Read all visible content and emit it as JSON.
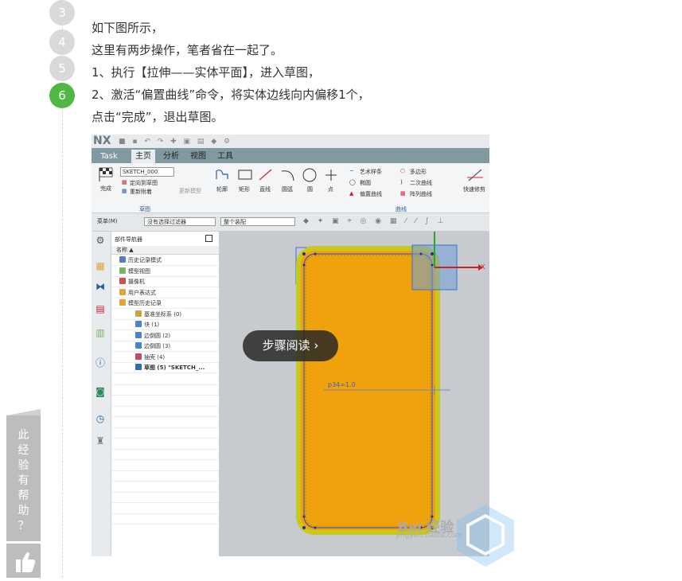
{
  "steps": [
    {
      "number": "3",
      "active": false
    },
    {
      "number": "4",
      "active": false
    },
    {
      "number": "5",
      "active": false
    },
    {
      "number": "6",
      "active": true
    }
  ],
  "text": {
    "line1": "如下图所示，",
    "line2": "这里有两步操作，笔者省在一起了。",
    "line3": "1、执行【拉伸——实体平面】，进入草图，",
    "line4": "2、激活“偏置曲线”命令，将实体边线向内偏移1个，",
    "line5": "点击“完成”，退出草图。"
  },
  "nx": {
    "logo": "NX",
    "tabs": {
      "task": "Task",
      "home": "主页",
      "analysis": "分析",
      "view": "视图",
      "tools": "工具"
    },
    "sketch_combo": "SKETCH_000",
    "ribbon": {
      "finish": "完成",
      "orient": "定向到草图",
      "reattach": "重新附着",
      "update": "更新模型",
      "sketch_group": "草图",
      "profile": "轮廓",
      "rectangle": "矩形",
      "line": "直线",
      "arc": "圆弧",
      "circle": "圆",
      "point": "点",
      "studio_spline": "艺术样条",
      "polygon": "多边形",
      "ellipse": "椭圆",
      "conic": "二次曲线",
      "offset_curve": "偏置曲线",
      "pattern_curve": "阵列曲线",
      "curve_group": "曲线",
      "quick_trim": "快速修剪"
    },
    "filterbar": {
      "menu": "菜单(M)",
      "filter": "没有选择过滤器",
      "assembly": "整个装配"
    },
    "navigator": {
      "title": "部件导航器",
      "column": "名称",
      "rows": [
        {
          "label": "历史记录模式",
          "indent": 1,
          "color": "#5b7fb5"
        },
        {
          "label": "模型视图",
          "indent": 1,
          "color": "#7bb36a"
        },
        {
          "label": "摄像机",
          "indent": 1,
          "color": "#d05050"
        },
        {
          "label": "用户表达式",
          "indent": 1,
          "color": "#e0a63a"
        },
        {
          "label": "模型历史记录",
          "indent": 1,
          "color": "#e0a63a"
        },
        {
          "label": "基准坐标系 (0)",
          "indent": 2,
          "color": "#c9a53b"
        },
        {
          "label": "块 (1)",
          "indent": 2,
          "color": "#4d82c9"
        },
        {
          "label": "边倒圆 (2)",
          "indent": 2,
          "color": "#4d82c9"
        },
        {
          "label": "边倒圆 (3)",
          "indent": 2,
          "color": "#4d82c9"
        },
        {
          "label": "抽壳 (4)",
          "indent": 2,
          "color": "#c54b6c"
        },
        {
          "label": "草图 (5) \"SKETCH_...",
          "indent": 2,
          "color": "#2e6db3",
          "bold": true
        }
      ]
    },
    "canvas": {
      "dimension": "p34=1.0",
      "axis_x": "X"
    }
  },
  "read_button": "步骤阅读",
  "watermark": {
    "brand": "Bai 经验",
    "url": "jingyan.baidu.com"
  },
  "feedback": {
    "text": "此经验有帮助？",
    "chars": [
      "此",
      "经",
      "验",
      "有",
      "帮",
      "助",
      "？"
    ]
  },
  "colors": {
    "accent": "#4fb842",
    "step_gray": "#d9d9d9",
    "part_fill": "#f0a20c",
    "part_edge": "#c8c81e"
  }
}
